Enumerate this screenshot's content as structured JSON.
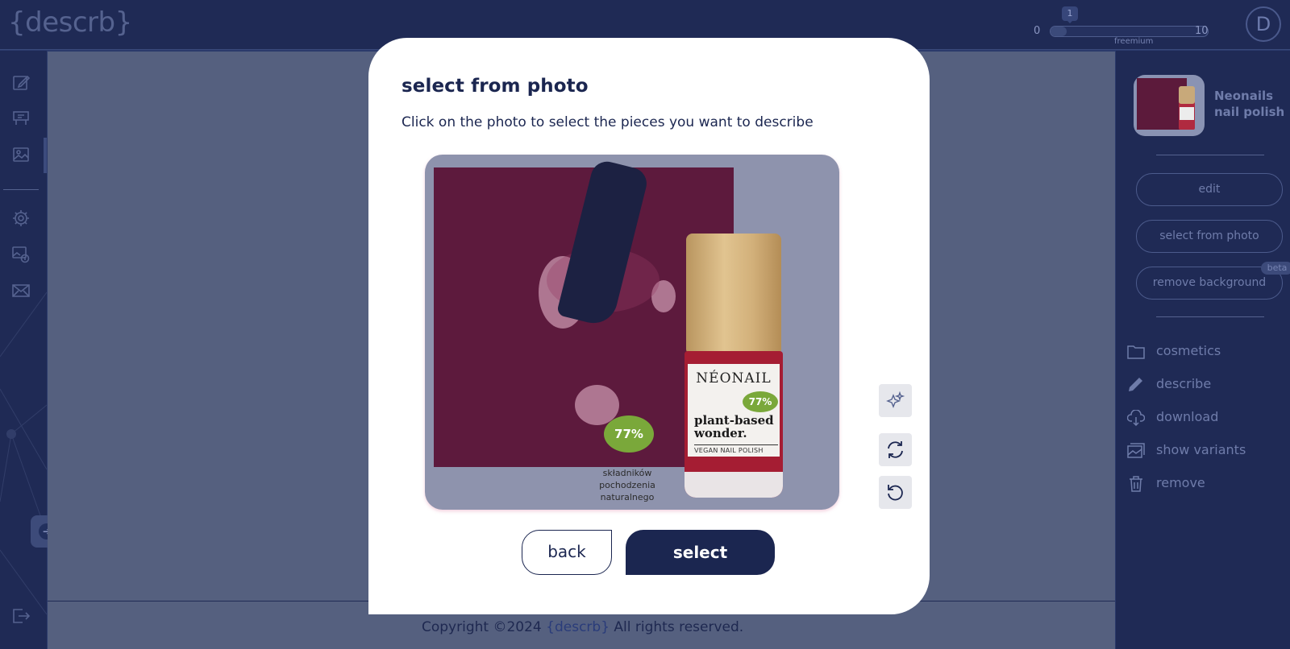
{
  "app": {
    "logo": "{descrb}"
  },
  "quota": {
    "min": "0",
    "max": "10",
    "current": "1",
    "fill_fraction": 0.1,
    "plan": "freemium"
  },
  "user": {
    "avatar_initial": "D"
  },
  "sidebar": {
    "items": [
      {
        "icon": "edit-icon"
      },
      {
        "icon": "billboard-icon"
      },
      {
        "icon": "image-icon"
      },
      {
        "icon": "gear-icon"
      },
      {
        "icon": "image-settings-icon"
      },
      {
        "icon": "envelope-icon"
      },
      {
        "icon": "logout-icon"
      }
    ]
  },
  "product_panel": {
    "product_name": "Neonails nail polish",
    "buttons": {
      "edit": "edit",
      "select_from_photo": "select from photo",
      "remove_background": "remove background",
      "beta_badge": "beta"
    },
    "actions": [
      {
        "icon": "folder-icon",
        "label": "cosmetics"
      },
      {
        "icon": "pencil-icon",
        "label": "describe"
      },
      {
        "icon": "cloud-download-icon",
        "label": "download"
      },
      {
        "icon": "images-icon",
        "label": "show variants"
      },
      {
        "icon": "trash-icon",
        "label": "remove"
      }
    ]
  },
  "modal": {
    "title": "select from photo",
    "subtitle": "Click on the photo to select the pieces you want to describe",
    "photo": {
      "badge_percent": "77%",
      "badge_caption": "składników pochodzenia naturalnego",
      "bottle_brand": "NÉONAIL",
      "bottle_percent": "77%",
      "bottle_claim": "plant-based wonder.",
      "bottle_subclaim": "VEGAN NAIL POLISH"
    },
    "tools": [
      {
        "icon": "sparkles-icon"
      },
      {
        "icon": "refresh-icon"
      },
      {
        "icon": "undo-icon"
      }
    ],
    "back_label": "back",
    "select_label": "select"
  },
  "footer": {
    "prefix": "Copyright ©2024",
    "brand": "{descrb}",
    "suffix": "All rights reserved."
  },
  "colors": {
    "navy": "#1b2650",
    "background": "#1f2a55",
    "overlay_main": "#55607f",
    "accent_green": "#7aa83a",
    "polish_red": "#a51d33"
  }
}
